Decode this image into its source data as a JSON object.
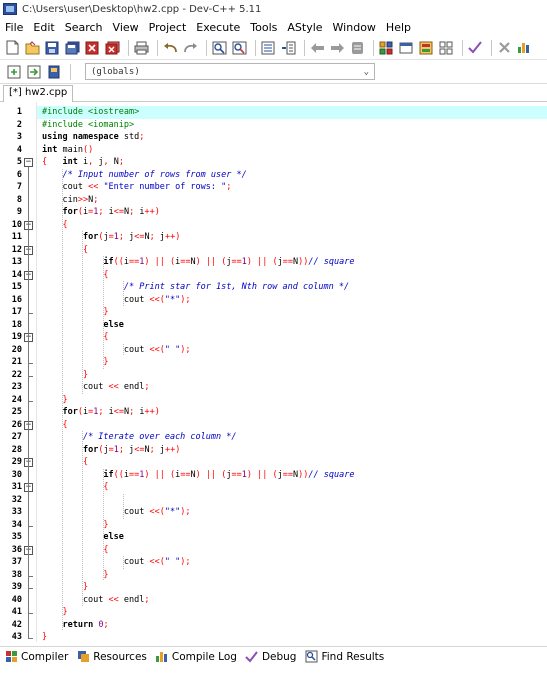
{
  "window": {
    "title": "C:\\Users\\user\\Desktop\\hw2.cpp - Dev-C++ 5.11"
  },
  "menu": [
    "File",
    "Edit",
    "Search",
    "View",
    "Project",
    "Execute",
    "Tools",
    "AStyle",
    "Window",
    "Help"
  ],
  "scope_selector": {
    "value": "(globals)"
  },
  "tab": {
    "label": "[*] hw2.cpp"
  },
  "bottom_tabs": [
    "Compiler",
    "Resources",
    "Compile Log",
    "Debug",
    "Find Results"
  ],
  "code": [
    "#include <iostream>",
    "#include <iomanip>",
    "using namespace std;",
    "int main()",
    "{   int i, j, N;",
    "    /* Input number of rows from user */",
    "    cout << \"Enter number of rows: \";",
    "    cin>>N;",
    "    for(i=1; i<=N; i++)",
    "    {",
    "        for(j=1; j<=N; j++)",
    "        {",
    "            if((i==1) || (i==N) || (j==1) || (j==N))// square",
    "            {",
    "                /* Print star for 1st, Nth row and column */",
    "                cout <<(\"*\");",
    "            }",
    "            else",
    "            {",
    "                cout <<(\" \");",
    "            }",
    "        }",
    "        cout << endl;",
    "    }",
    "    for(i=1; i<=N; i++)",
    "    {",
    "        /* Iterate over each column */",
    "        for(j=1; j<=N; j++)",
    "        {",
    "            if((i==1) || (i==N) || (j==1) || (j==N))// square",
    "            {",
    "",
    "                cout <<(\"*\");",
    "            }",
    "            else",
    "            {",
    "                cout <<(\" \");",
    "            }",
    "        }",
    "        cout << endl;",
    "    }",
    "    return 0;",
    "}"
  ],
  "colors": {
    "keyword": "#000000",
    "preprocessor": "#008000",
    "comment": "#0000c8",
    "string": "#0000c8",
    "symbol": "#ff0000",
    "number": "#800080",
    "current_line": "#ccffff"
  },
  "toolbar_icons": [
    "new-file-icon",
    "open-file-icon",
    "save-icon",
    "save-all-icon",
    "close-icon",
    "close-all-icon",
    "print-icon",
    "undo-icon",
    "redo-icon",
    "find-icon",
    "replace-icon",
    "indent-icon",
    "unindent-icon",
    "toggle-bookmark-icon",
    "goto-bookmark-icon",
    "comment-icon",
    "new-project-icon",
    "open-project-icon",
    "class-icon",
    "grid-icon",
    "check-icon",
    "delete-icon",
    "chart-icon"
  ]
}
